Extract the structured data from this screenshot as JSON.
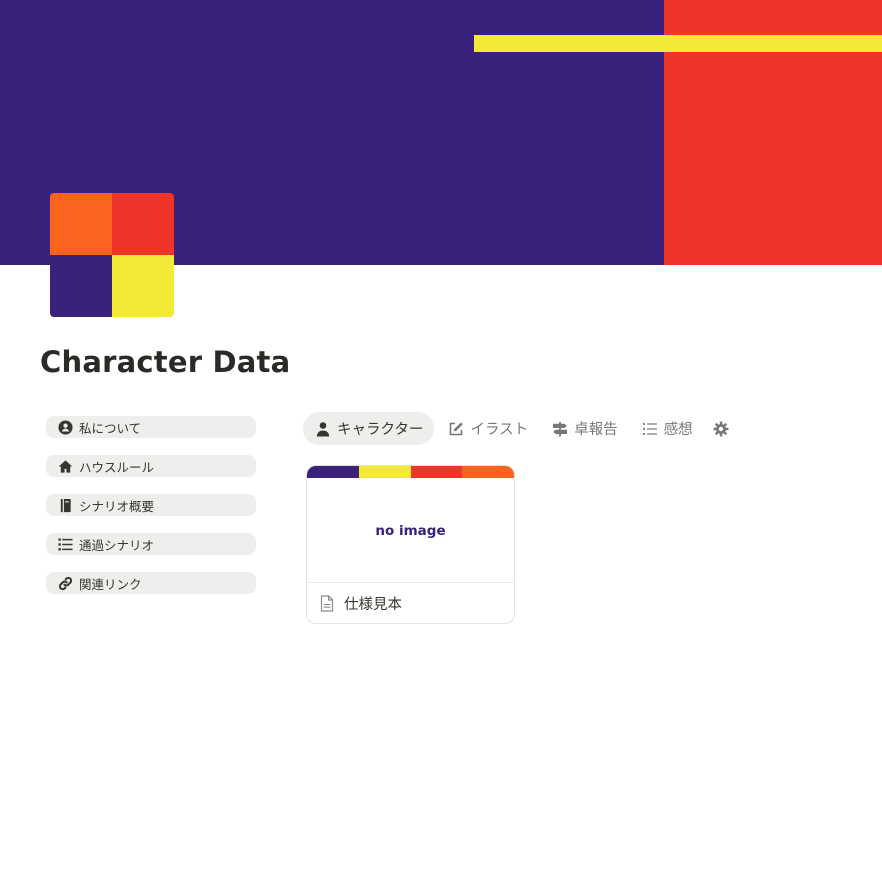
{
  "page": {
    "title": "Character Data",
    "cover_colors": {
      "purple": "#3a217b",
      "red": "#ef3429",
      "yellow": "#f3ea35",
      "orange": "#fb641f"
    }
  },
  "sidebar": {
    "links": [
      {
        "label": "私について",
        "icon": "user-circle-icon"
      },
      {
        "label": "ハウスルール",
        "icon": "home-icon"
      },
      {
        "label": "シナリオ概要",
        "icon": "book-icon"
      },
      {
        "label": "通過シナリオ",
        "icon": "list-icon"
      },
      {
        "label": "関連リンク",
        "icon": "link-icon"
      }
    ]
  },
  "tabs": [
    {
      "label": "キャラクター",
      "icon": "user-icon",
      "active": true
    },
    {
      "label": "イラスト",
      "icon": "edit-icon",
      "active": false
    },
    {
      "label": "卓報告",
      "icon": "signpost-icon",
      "active": false
    },
    {
      "label": "感想",
      "icon": "bullet-list-icon",
      "active": false
    },
    {
      "label": "",
      "icon": "gear-icon",
      "active": false
    }
  ],
  "gallery": {
    "cards": [
      {
        "placeholder": "no image",
        "title": "仕様見本",
        "icon": "page-icon"
      }
    ]
  }
}
